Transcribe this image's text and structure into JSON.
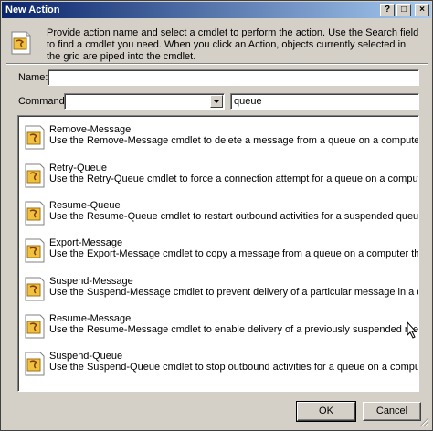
{
  "window": {
    "title": "New Action"
  },
  "titlebar_buttons": {
    "help": "?",
    "maximize": "□",
    "close": "×"
  },
  "intro": {
    "text": "Provide action name and select a cmdlet to perform the action. Use the Search field to find a cmdlet you need. When you click an Action, objects currently selected in the grid are piped into the cmdlet."
  },
  "form": {
    "name_label": "Name:",
    "name_value": "",
    "command_label": "Command:",
    "command_value": "",
    "search_value": "queue"
  },
  "cmdlets": [
    {
      "name": "Remove-Message",
      "description": "Use the Remove-Message cmdlet to delete a message from a queue on a computer that h..."
    },
    {
      "name": "Retry-Queue",
      "description": "Use the Retry-Queue cmdlet to force a connection attempt for a queue on a computer that ..."
    },
    {
      "name": "Resume-Queue",
      "description": "Use the Resume-Queue cmdlet to restart outbound activities for a suspended queue on a c..."
    },
    {
      "name": "Export-Message",
      "description": "Use the Export-Message cmdlet to copy a message from a queue on a computer that has t..."
    },
    {
      "name": "Suspend-Message",
      "description": "Use the Suspend-Message cmdlet to prevent delivery of a particular message in a queue o..."
    },
    {
      "name": "Resume-Message",
      "description": "Use the Resume-Message cmdlet to enable delivery of a previously suspended message in..."
    },
    {
      "name": "Suspend-Queue",
      "description": "Use the Suspend-Queue cmdlet to stop outbound activities for a queue on a computer that..."
    }
  ],
  "buttons": {
    "ok": "OK",
    "cancel": "Cancel"
  },
  "icons": {
    "cmdlet": "script-scroll-icon",
    "intro": "script-scroll-icon"
  },
  "colors": {
    "titlebar_start": "#0a246a",
    "titlebar_end": "#a6caf0",
    "dialog_bg": "#d4d0c8"
  }
}
